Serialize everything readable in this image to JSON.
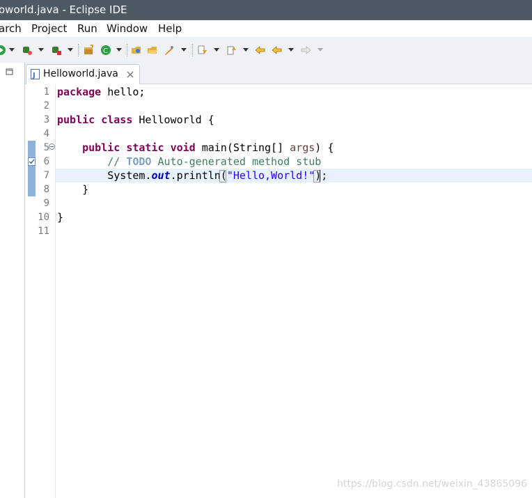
{
  "window": {
    "title": "oworld.java - Eclipse IDE"
  },
  "menu": [
    "arch",
    "Project",
    "Run",
    "Window",
    "Help"
  ],
  "toolbar": {
    "icons": [
      "run-icon",
      "debug-icon",
      "coverage-icon",
      "new-package-icon",
      "new-class-icon",
      "open-type-icon",
      "open-folder-icon",
      "search-icon",
      "next-annotation-icon",
      "previous-annotation-icon",
      "last-edit-location-icon",
      "back-icon",
      "forward-icon"
    ]
  },
  "editor": {
    "tab_title": "Helloworld.java",
    "line_numbers": [
      "1",
      "2",
      "3",
      "4",
      "5",
      "6",
      "7",
      "8",
      "9",
      "10",
      "11"
    ],
    "lines": {
      "l1": {
        "kw": "package",
        "rest": " hello;"
      },
      "l3": {
        "kw1": "public",
        "kw2": "class",
        "rest": " Helloworld {"
      },
      "l5": {
        "indent": "    ",
        "kw1": "public",
        "kw2": "static",
        "kw3": "void",
        "mid": " main(String[] ",
        "param": "args",
        "rest": ") {"
      },
      "l6": {
        "indent": "        ",
        "comment": "// ",
        "todo": "TODO",
        "comment_rest": " Auto-generated method stub"
      },
      "l7": {
        "indent": "        ",
        "pre": "System.",
        "field": "out",
        "mid": ".println(",
        "string": "\"Hello,World!\"",
        "rest": ");"
      },
      "l8": {
        "text": "    }"
      },
      "l10": {
        "text": "}"
      }
    }
  },
  "watermark": "https://blog.csdn.net/weixin_43865096",
  "colors": {
    "keyword": "#7f0055",
    "comment": "#3f7f5f",
    "string": "#2a00ff",
    "titlebar": "#4d5a66",
    "current_line": "#e8f2fe"
  }
}
